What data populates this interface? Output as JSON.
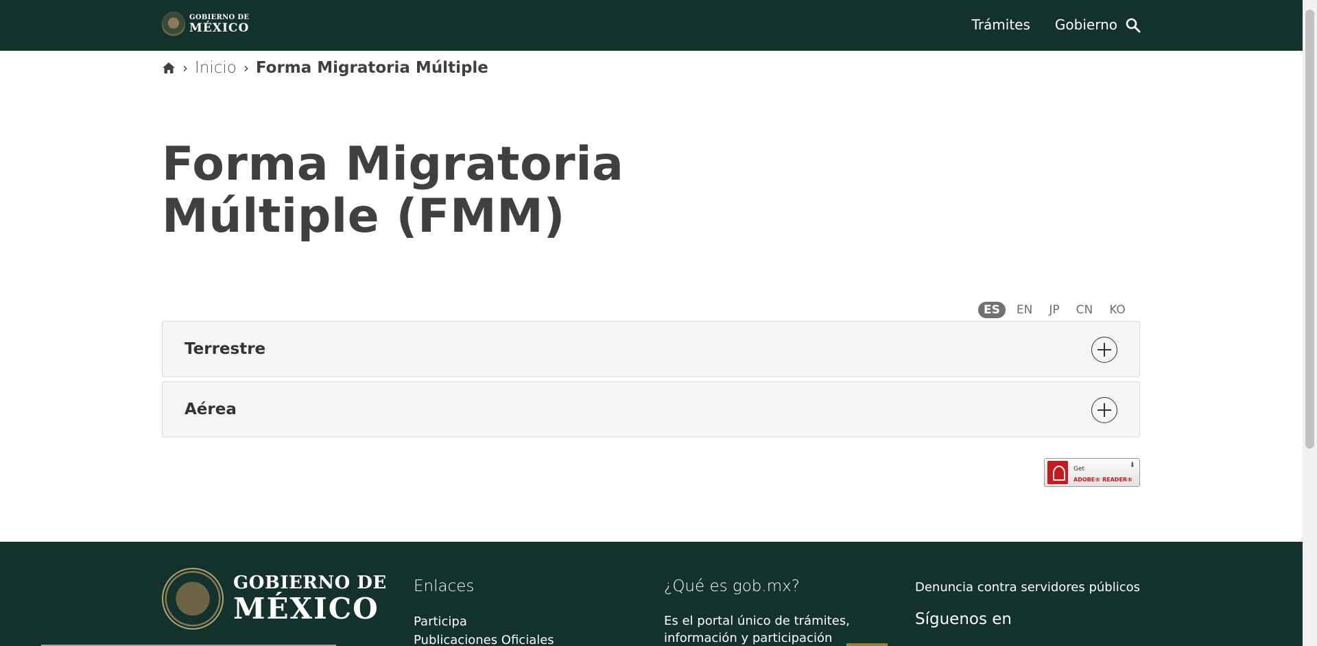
{
  "header": {
    "logo_line1": "GOBIERNO DE",
    "logo_line2": "MÉXICO",
    "nav": [
      "Trámites",
      "Gobierno"
    ],
    "search_icon": "search-icon",
    "bg_color": "#13322b"
  },
  "breadcrumb": {
    "home_icon": "home-icon",
    "items": [
      "Inicio",
      "Forma Migratoria Múltiple"
    ],
    "separator": "›"
  },
  "main": {
    "title": "Forma Migratoria Múltiple (FMM)",
    "languages": [
      "ES",
      "EN",
      "JP",
      "CN",
      "KO"
    ],
    "active_language": "ES",
    "accordion": [
      {
        "label": "Terrestre"
      },
      {
        "label": "Aérea"
      }
    ],
    "adobe_badge": {
      "get": "Get",
      "reader": "ADOBE® READER®"
    }
  },
  "footer": {
    "logo_line1": "GOBIERNO DE",
    "logo_line2": "MÉXICO",
    "links_title": "Enlaces",
    "links": [
      "Participa",
      "Publicaciones Oficiales"
    ],
    "what_title": "¿Qué es gob.mx?",
    "what_text": "Es el portal único de trámites, información y participación",
    "denuncia": "Denuncia contra servidores públicos",
    "siguenos": "Síguenos en",
    "bg_color": "#13322b",
    "accent_color": "#a57f2c"
  }
}
